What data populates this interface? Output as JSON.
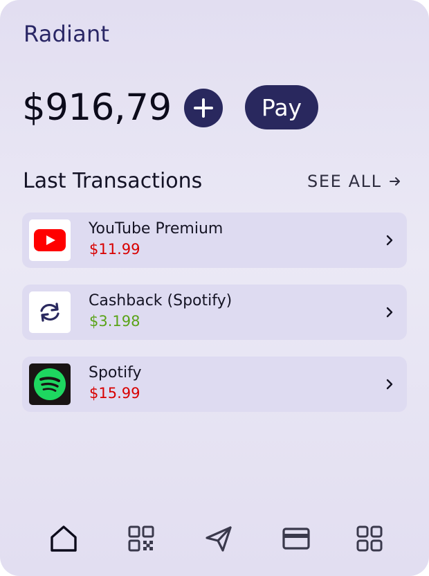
{
  "app": {
    "title": "Radiant"
  },
  "balance": {
    "amount": "$916,79"
  },
  "actions": {
    "add_label": "+",
    "pay_label": "Pay"
  },
  "transactions": {
    "heading": "Last Transactions",
    "see_all_label": "SEE ALL",
    "items": [
      {
        "name": "YouTube Premium",
        "amount": "$11.99",
        "direction": "debit",
        "icon": "youtube-logo-icon",
        "color": "#d80000"
      },
      {
        "name": "Cashback (Spotify)",
        "amount": "$3.198",
        "direction": "credit",
        "icon": "refresh-sync-icon",
        "color": "#5aa318"
      },
      {
        "name": "Spotify",
        "amount": "$15.99",
        "direction": "debit",
        "icon": "spotify-logo-icon",
        "color": "#d80000"
      }
    ]
  },
  "nav": {
    "active": "home",
    "items": [
      "home-icon",
      "qr-code-icon",
      "send-icon",
      "card-icon",
      "grid-icon"
    ]
  },
  "colors": {
    "brand": "#29285e",
    "debit": "#d80000",
    "credit": "#5aa318",
    "background": "#e6e3f3"
  }
}
